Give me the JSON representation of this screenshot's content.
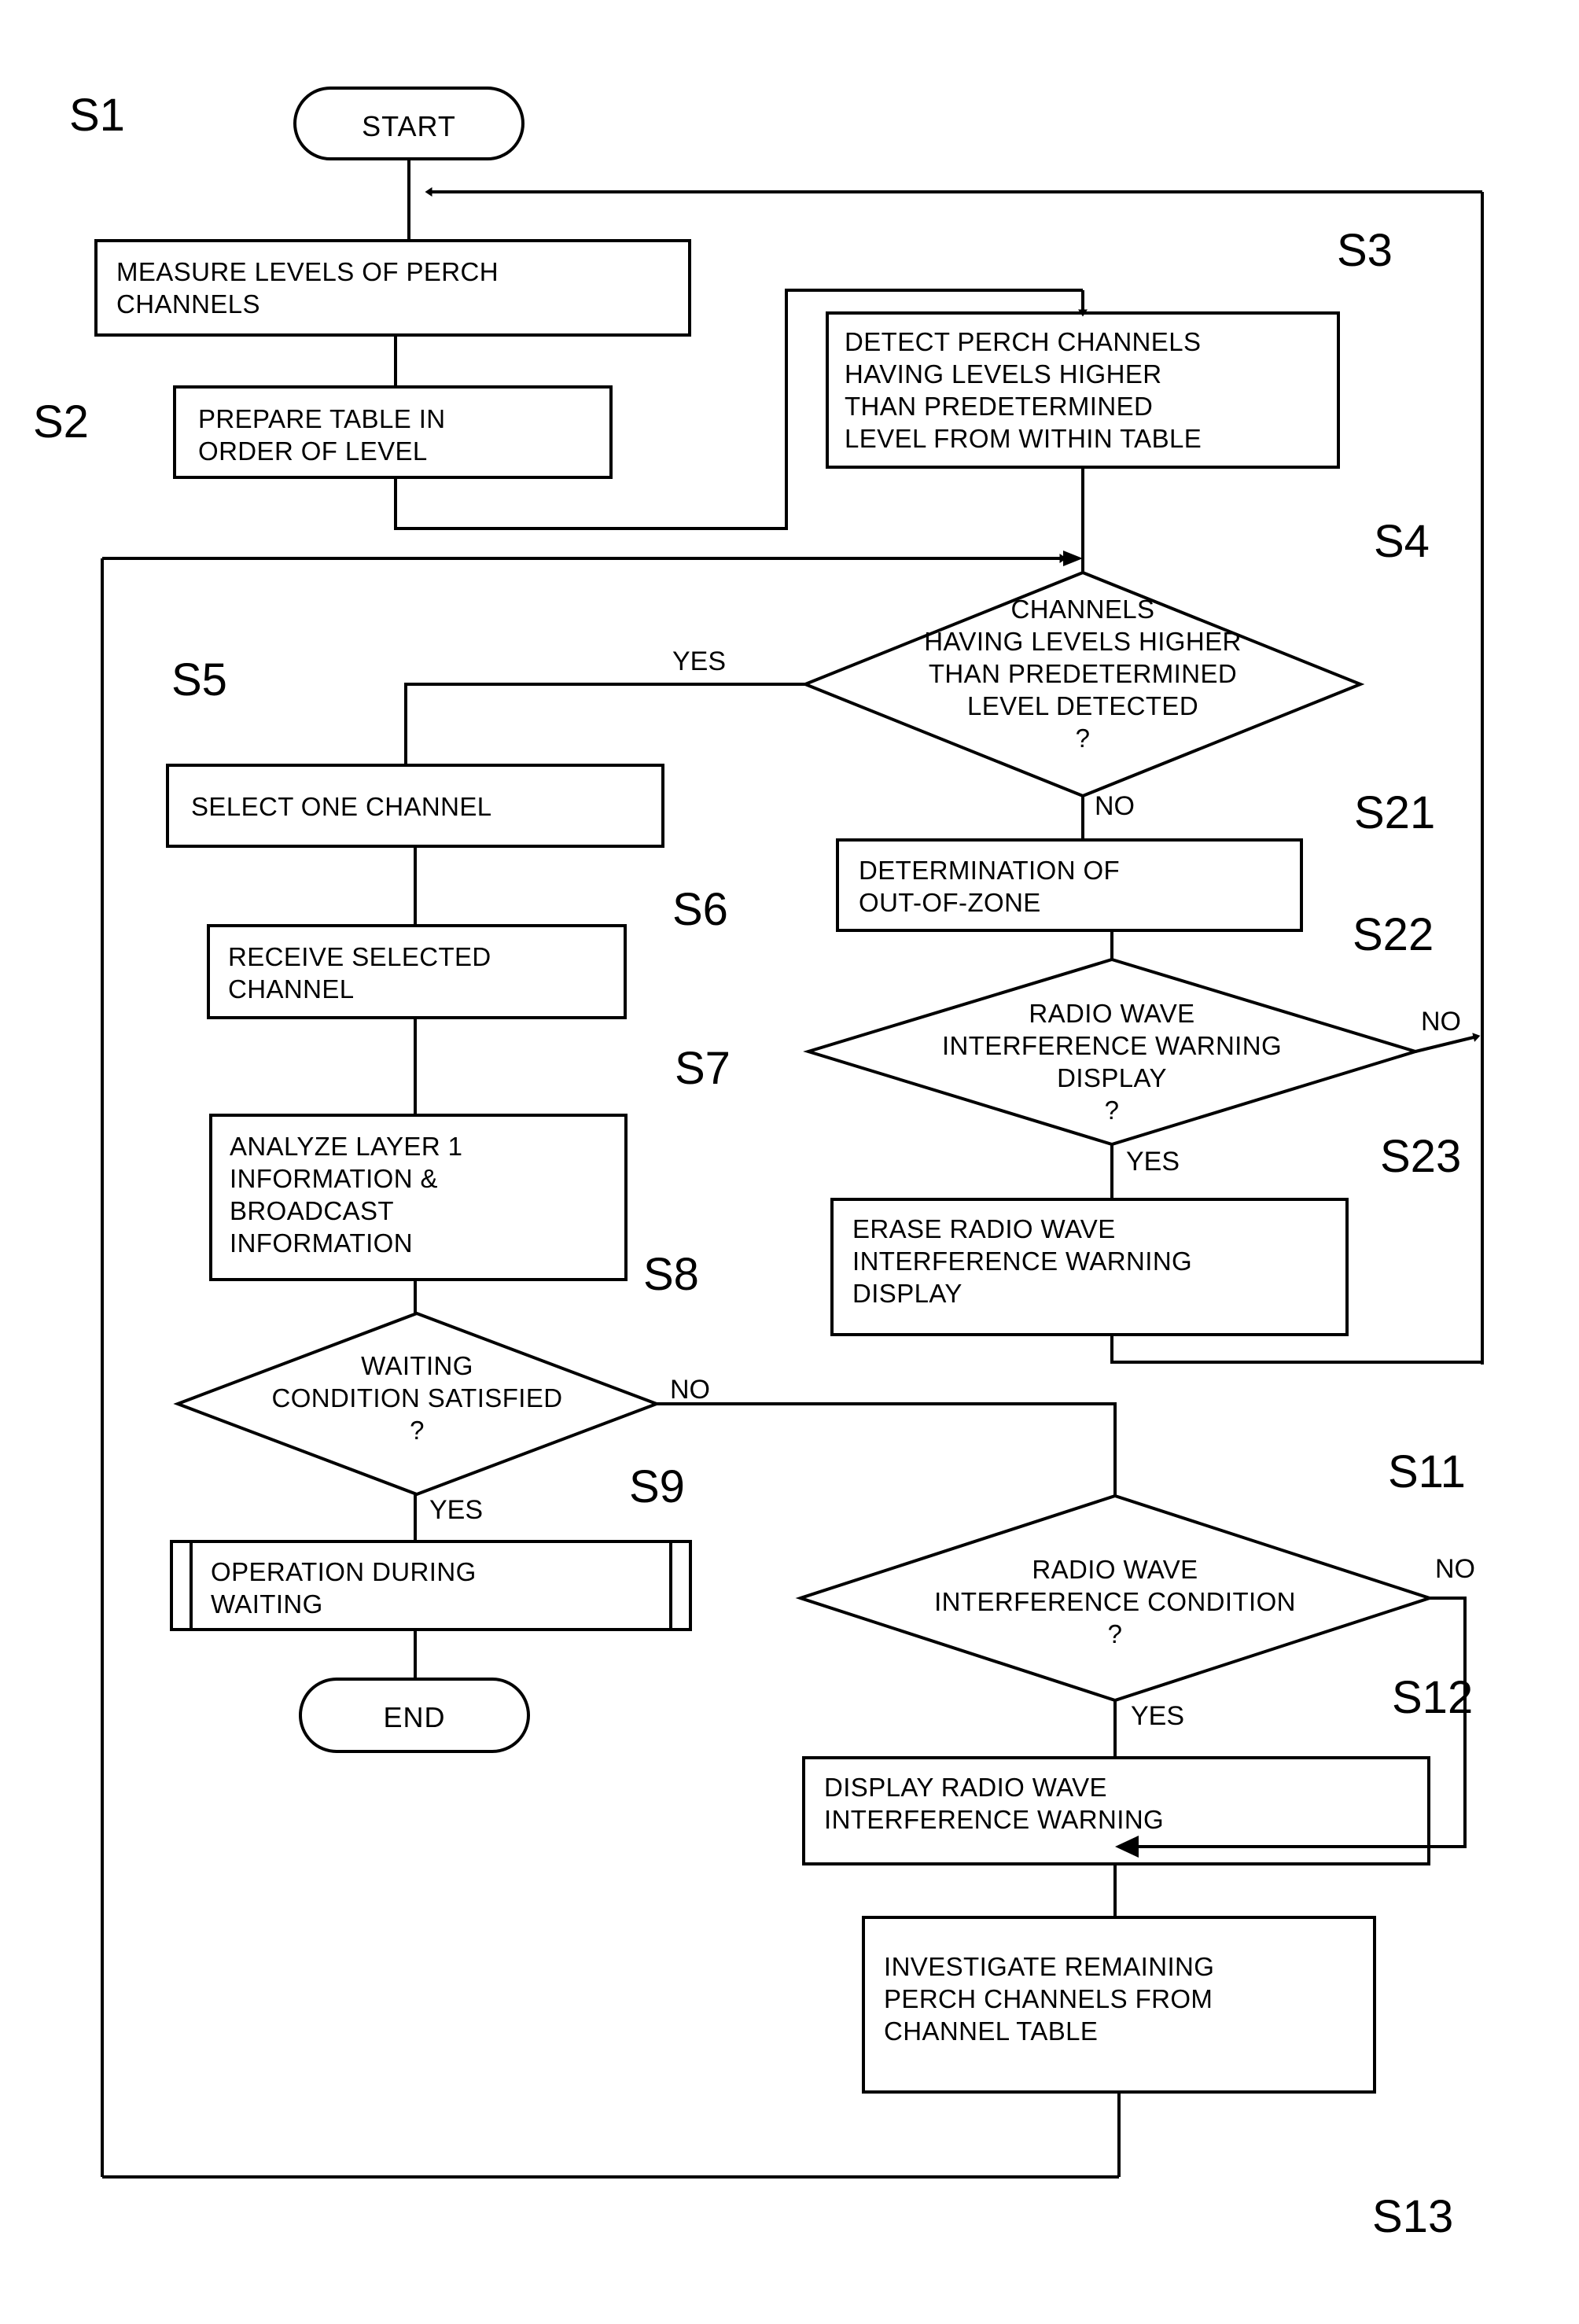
{
  "figure": {
    "type": "flowchart",
    "orientation": "vertical",
    "stroke_color": "#000000",
    "background_color": "#ffffff"
  },
  "terminals": {
    "start": "START",
    "end": "END"
  },
  "branch_labels": {
    "s4_yes": "YES",
    "s4_no": "NO",
    "s8_no": "NO",
    "s8_yes": "YES",
    "s22_no": "NO",
    "s22_yes": "YES",
    "s11_no": "NO",
    "s11_yes": "YES"
  },
  "steps": [
    {
      "id": "S1",
      "label": "S1",
      "shape": "process",
      "lines": [
        "MEASURE LEVELS OF PERCH",
        "CHANNELS"
      ]
    },
    {
      "id": "S2",
      "label": "S2",
      "shape": "process",
      "lines": [
        "PREPARE TABLE IN",
        "ORDER OF LEVEL"
      ]
    },
    {
      "id": "S3",
      "label": "S3",
      "shape": "process",
      "lines": [
        "DETECT PERCH CHANNELS",
        "HAVING LEVELS HIGHER",
        "THAN PREDETERMINED",
        "LEVEL FROM WITHIN TABLE"
      ]
    },
    {
      "id": "S4",
      "label": "S4",
      "shape": "decision",
      "lines": [
        "CHANNELS",
        "HAVING LEVELS HIGHER",
        "THAN PREDETERMINED",
        "LEVEL DETECTED",
        "?"
      ]
    },
    {
      "id": "S5",
      "label": "S5",
      "shape": "process",
      "lines": [
        "SELECT ONE CHANNEL"
      ]
    },
    {
      "id": "S6",
      "label": "S6",
      "shape": "process",
      "lines": [
        "RECEIVE SELECTED",
        "CHANNEL"
      ]
    },
    {
      "id": "S7",
      "label": "S7",
      "shape": "process",
      "lines": [
        "ANALYZE LAYER 1",
        "INFORMATION &",
        "BROADCAST",
        "INFORMATION"
      ]
    },
    {
      "id": "S8",
      "label": "S8",
      "shape": "decision",
      "lines": [
        "WAITING",
        "CONDITION SATISFIED",
        "?"
      ]
    },
    {
      "id": "S9",
      "label": "S9",
      "shape": "predefined-process",
      "lines": [
        "OPERATION DURING",
        "WAITING"
      ]
    },
    {
      "id": "S21",
      "label": "S21",
      "shape": "process",
      "lines": [
        "DETERMINATION OF",
        "OUT-OF-ZONE"
      ]
    },
    {
      "id": "S22",
      "label": "S22",
      "shape": "decision",
      "lines": [
        "RADIO WAVE",
        "INTERFERENCE WARNING",
        "DISPLAY",
        "?"
      ]
    },
    {
      "id": "S23",
      "label": "S23",
      "shape": "process",
      "lines": [
        "ERASE RADIO WAVE",
        "INTERFERENCE WARNING",
        "DISPLAY"
      ]
    },
    {
      "id": "S11",
      "label": "S11",
      "shape": "decision",
      "lines": [
        "RADIO WAVE",
        "INTERFERENCE CONDITION",
        "?"
      ]
    },
    {
      "id": "S12",
      "label": "S12",
      "shape": "process",
      "lines": [
        "DISPLAY RADIO WAVE",
        "INTERFERENCE WARNING"
      ]
    },
    {
      "id": "S13",
      "label": "S13",
      "shape": "process",
      "lines": [
        "INVESTIGATE REMAINING",
        "PERCH CHANNELS FROM",
        "CHANNEL TABLE"
      ]
    }
  ]
}
